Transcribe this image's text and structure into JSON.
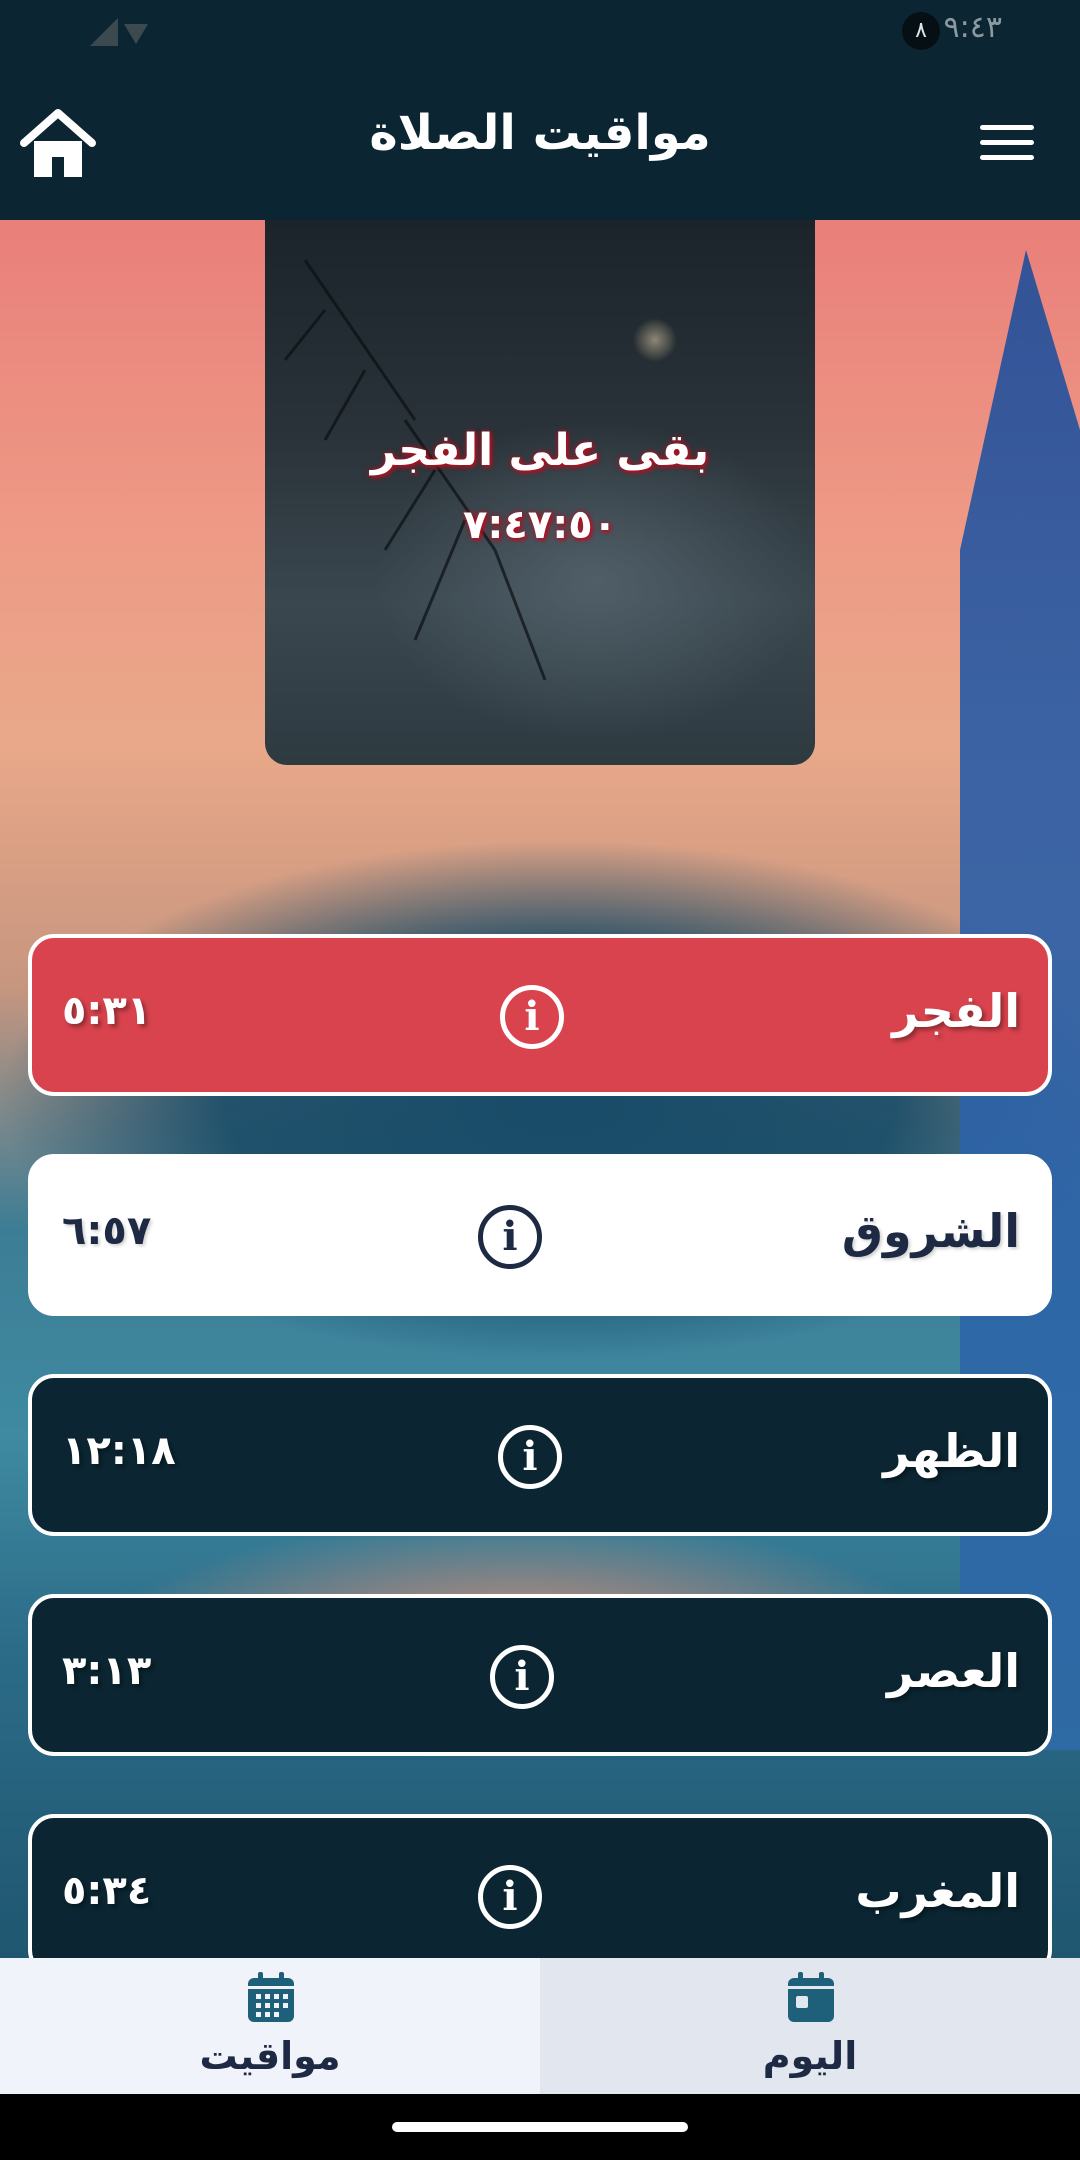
{
  "status_bar": {
    "time": "٩:٤٣",
    "notification_count": "٨"
  },
  "app_bar": {
    "title": "مواقيت الصلاة"
  },
  "countdown": {
    "label": "بقى على الفجر",
    "value": "٧:٤٧:٥٠"
  },
  "prayers": [
    {
      "name": "الفجر",
      "time": "٥:٣١",
      "state": "active"
    },
    {
      "name": "الشروق",
      "time": "٦:٥٧",
      "state": "light"
    },
    {
      "name": "الظهر",
      "time": "١٢:١٨",
      "state": "normal"
    },
    {
      "name": "العصر",
      "time": "٣:١٣",
      "state": "normal"
    },
    {
      "name": "المغرب",
      "time": "٥:٣٤",
      "state": "normal"
    }
  ],
  "bottom_nav": {
    "items": [
      {
        "label": "مواقيت",
        "icon": "calendar-grid-icon",
        "selected": false
      },
      {
        "label": "اليوم",
        "icon": "calendar-today-icon",
        "selected": true
      }
    ]
  },
  "colors": {
    "primary_dark": "#0b2632",
    "active_red": "#d9434d",
    "text_dark": "#1e2a44",
    "countdown_glow": "#b40f1f"
  },
  "info_icon_glyph": "i"
}
